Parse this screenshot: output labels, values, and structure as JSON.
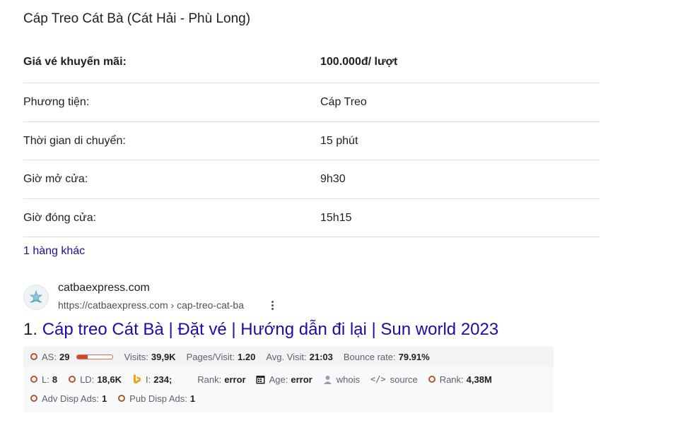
{
  "heading": "Cáp Treo Cát Bà (Cát Hải - Phù Long)",
  "table": [
    {
      "key": "Giá vé khuyến mãi:",
      "value": "100.000đ/ lượt"
    },
    {
      "key": "Phương tiện:",
      "value": "Cáp Treo"
    },
    {
      "key": "Thời gian di chuyển:",
      "value": "15 phút"
    },
    {
      "key": "Giờ mở cửa:",
      "value": "9h30"
    },
    {
      "key": "Giờ đóng cửa:",
      "value": "15h15"
    }
  ],
  "more_rows": "1 hàng khác",
  "result": {
    "site_name": "catbaexpress.com",
    "url": "https://catbaexpress.com › cap-treo-cat-ba",
    "number": "1.",
    "title": "Cáp treo Cát Bà | Đặt vé | Hướng dẫn đi lại | Sun world 2023"
  },
  "seo": {
    "row1": {
      "as_label": "AS:",
      "as_value": "29",
      "as_fraction": 0.29,
      "visits_label": "Visits:",
      "visits_value": "39,9K",
      "ppv_label": "Pages/Visit:",
      "ppv_value": "1.20",
      "avg_label": "Avg. Visit:",
      "avg_value": "21:03",
      "bounce_label": "Bounce rate:",
      "bounce_value": "79.91%"
    },
    "row2": {
      "l_label": "L:",
      "l_value": "8",
      "ld_label": "LD:",
      "ld_value": "18,6K",
      "i_label": "I:",
      "i_value": "234;",
      "rank_label": "Rank:",
      "rank_value": "error",
      "age_label": "Age:",
      "age_value": "error",
      "whois": "whois",
      "source": "source",
      "rank2_label": "Rank:",
      "rank2_value": "4,38M"
    },
    "row3": {
      "adv_label": "Adv Disp Ads:",
      "adv_value": "1",
      "pub_label": "Pub Disp Ads:",
      "pub_value": "1"
    }
  },
  "colors": {
    "link": "#1a0dab",
    "accent": "#c94a2c",
    "bing": "#f0a30a"
  }
}
